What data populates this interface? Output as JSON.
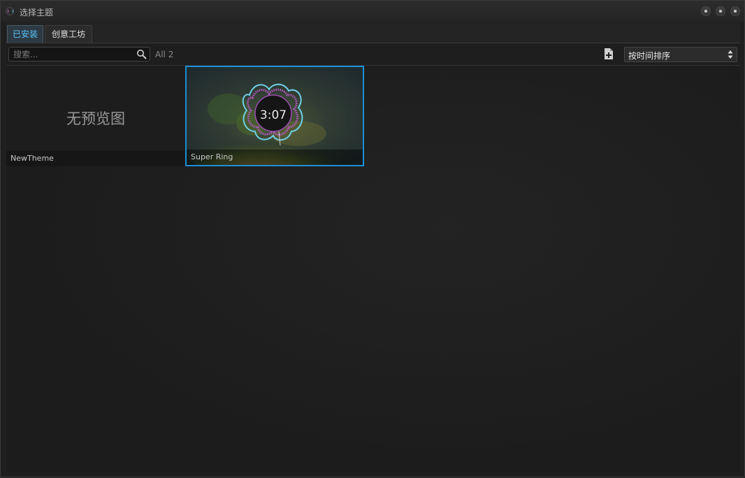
{
  "window": {
    "title": "选择主题"
  },
  "tabs": [
    {
      "label": "已安装",
      "active": true
    },
    {
      "label": "创意工坊",
      "active": false
    }
  ],
  "toolbar": {
    "search_placeholder": "搜索...",
    "count_label": "All 2",
    "sort_value": "按时间排序"
  },
  "themes": [
    {
      "name": "NewTheme",
      "no_preview_text": "无预览图",
      "selected": false
    },
    {
      "name": "Super Ring",
      "clock_text": "3:07",
      "selected": true
    }
  ],
  "colors": {
    "accent": "#1a8fd6",
    "active_tab_text": "#5ac8ff",
    "background": "#1f1f1f"
  },
  "icons": {
    "search": "search-icon",
    "add": "add-file-icon",
    "sort_arrows": "up-down-arrows-icon",
    "window_buttons": [
      "minimize-icon",
      "maximize-icon",
      "close-icon"
    ]
  }
}
